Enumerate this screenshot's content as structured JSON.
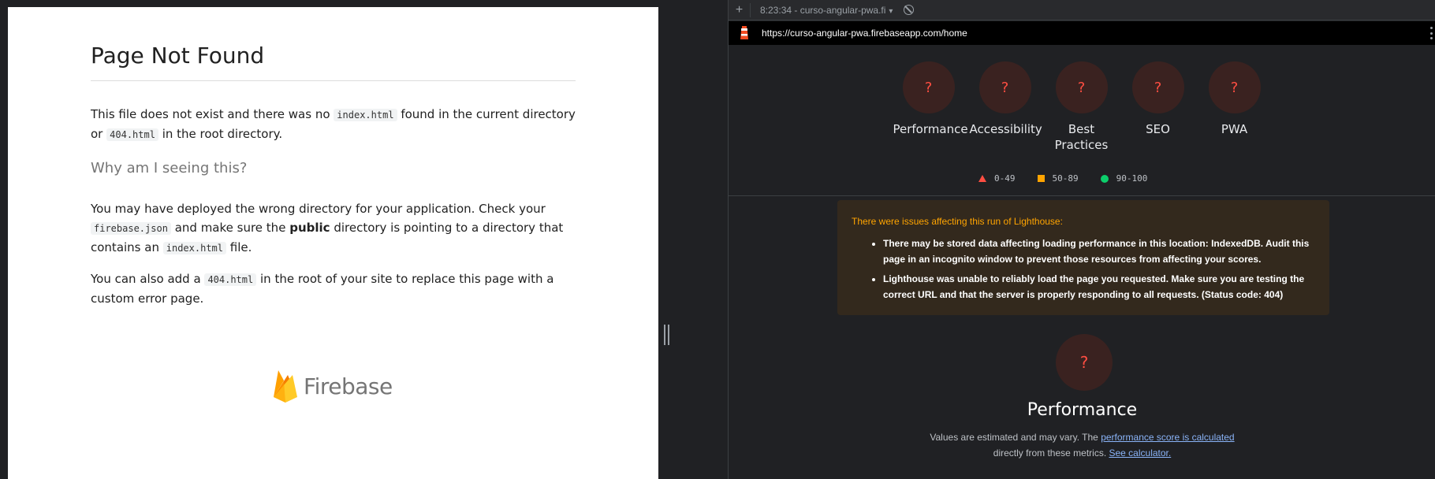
{
  "page": {
    "title": "Page Not Found",
    "p1_a": "This file does not exist and there was no",
    "p1_code1": "index.html",
    "p1_b": "found in the current directory or",
    "p1_code2": "404.html",
    "p1_c": "in the root directory.",
    "subtitle": "Why am I seeing this?",
    "p2_a": "You may have deployed the wrong directory for your application. Check your",
    "p2_code1": "firebase.json",
    "p2_b": "and make sure the",
    "p2_bold": "public",
    "p2_c": "directory is pointing to a directory that contains an",
    "p2_code2": "index.html",
    "p2_d": "file.",
    "p3_a": "You can also add a",
    "p3_code": "404.html",
    "p3_b": "in the root of your site to replace this page with a custom error page.",
    "logo_text": "Firebase"
  },
  "devtools": {
    "toolbar": {
      "plus_label": "+",
      "report_label": "8:23:34 - curso-angular-pwa.fi",
      "dropdown_caret": "▾"
    },
    "url": "https://curso-angular-pwa.firebaseapp.com/home",
    "gauges": [
      {
        "label": "Performance",
        "score": "?"
      },
      {
        "label": "Accessibility",
        "score": "?"
      },
      {
        "label": "Best Practices",
        "score": "?"
      },
      {
        "label": "SEO",
        "score": "?"
      },
      {
        "label": "PWA",
        "score": "?"
      }
    ],
    "legend": {
      "fail": "0-49",
      "average": "50-89",
      "pass": "90-100"
    },
    "warning": {
      "title": "There were issues affecting this run of Lighthouse:",
      "items": [
        "There may be stored data affecting loading performance in this location: IndexedDB. Audit this page in an incognito window to prevent those resources from affecting your scores.",
        "Lighthouse was unable to reliably load the page you requested. Make sure you are testing the correct URL and that the server is properly responding to all requests. (Status code: 404)"
      ]
    },
    "performance": {
      "score": "?",
      "title": "Performance",
      "desc_a": "Values are estimated and may vary. The",
      "desc_link1": "performance score is calculated",
      "desc_b": "directly from these metrics.",
      "desc_link2": "See calculator."
    },
    "colors": {
      "fail": "#ff4e42",
      "average": "#ffa400",
      "pass": "#0cce6b",
      "link": "#8ab4f8"
    }
  }
}
